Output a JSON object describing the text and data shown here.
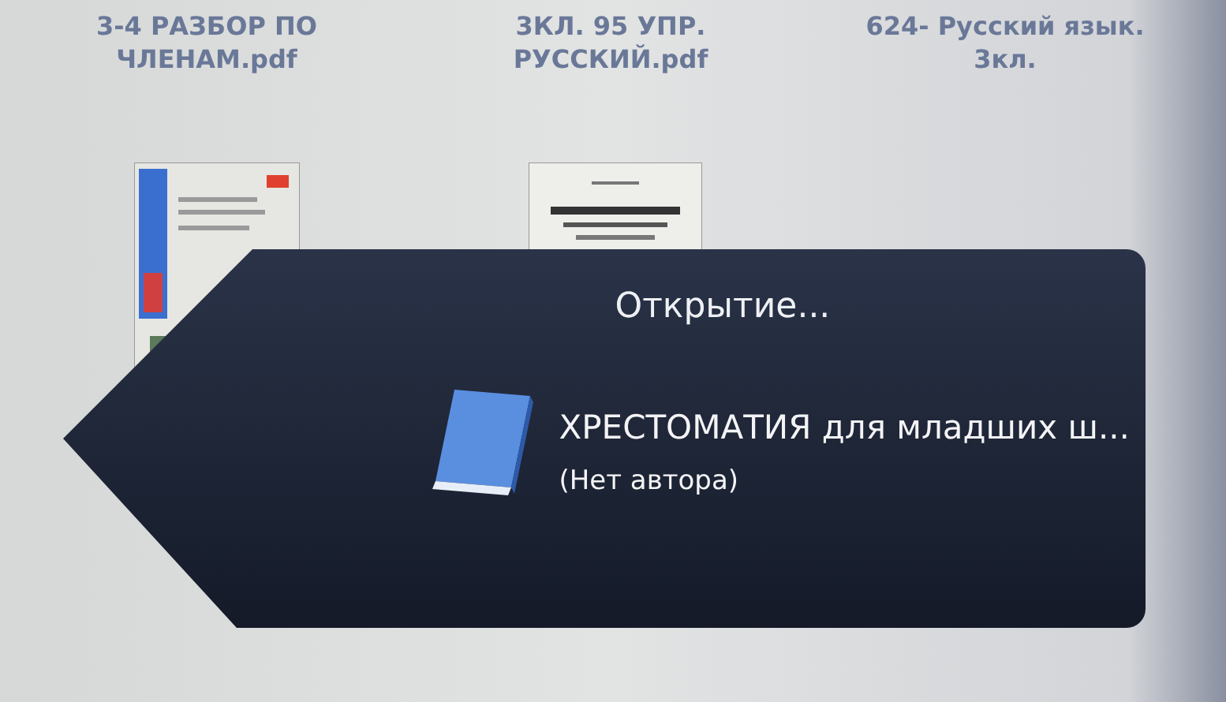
{
  "library": {
    "items": [
      {
        "title_lines": [
          "3-4 РАЗБОР ПО",
          "ЧЛЕНАМ.pdf"
        ]
      },
      {
        "title_lines": [
          "3КЛ. 95 УПР.",
          "РУССКИЙ.pdf"
        ]
      },
      {
        "title_lines": [
          "624- Русский язык.",
          "3кл."
        ]
      }
    ]
  },
  "opening_popup": {
    "status": "Открытие...",
    "book_title": "ХРЕСТОМАТИЯ для младших ш...",
    "author": "(Нет автора)"
  }
}
